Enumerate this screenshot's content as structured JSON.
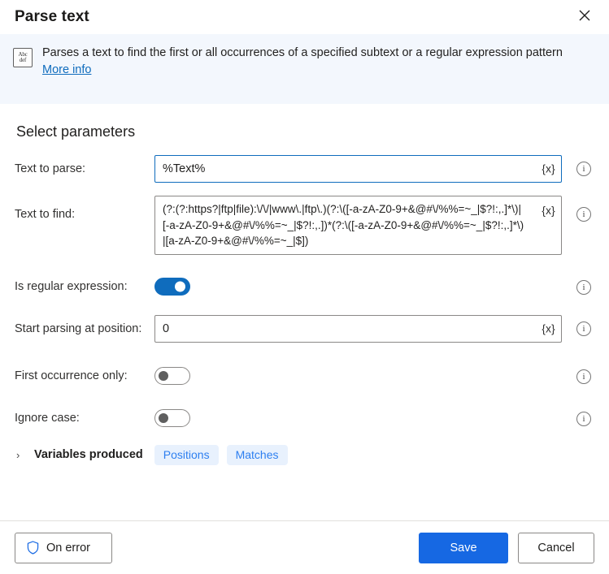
{
  "window": {
    "title": "Parse text",
    "close_label": "✕"
  },
  "banner": {
    "icon": "abc-def-text-icon",
    "icon_line1": "Abc",
    "icon_line2": "def",
    "description": "Parses a text to find the first or all occurrences of a specified subtext or a regular expression pattern",
    "link_label": "More info"
  },
  "form": {
    "section_title": "Select parameters",
    "variable_button_label": "{x}",
    "info_icon_label": "i",
    "fields": [
      {
        "label": "Text to parse:",
        "type": "text",
        "value": "%Text%",
        "focused": true,
        "has_variable_button": true,
        "has_info": true
      },
      {
        "label": "Text to find:",
        "type": "textarea",
        "value": "(?:(?:https?|ftp|file):\\/\\/|www\\.|ftp\\.)(?:\\([-a-zA-Z0-9+&@#\\/%%=~_|$?!:,.]*\\)|[-a-zA-Z0-9+&@#\\/%%=~_|$?!:,.])*(?:\\([-a-zA-Z0-9+&@#\\/%%=~_|$?!:,.]*\\)|[a-zA-Z0-9+&@#\\/%%=~_|$])",
        "focused": false,
        "has_variable_button": true,
        "has_info": true
      },
      {
        "label": "Is regular expression:",
        "type": "toggle",
        "state": "on",
        "has_info": true
      },
      {
        "label": "Start parsing at position:",
        "type": "text",
        "value": "0",
        "focused": false,
        "has_variable_button": true,
        "has_info": true
      },
      {
        "label": "First occurrence only:",
        "type": "toggle",
        "state": "off",
        "has_info": true
      },
      {
        "label": "Ignore case:",
        "type": "toggle",
        "state": "off",
        "has_info": true
      }
    ]
  },
  "variables_produced": {
    "chevron": "›",
    "label": "Variables produced",
    "chips": [
      "Positions",
      "Matches"
    ]
  },
  "footer": {
    "on_error_label": "On error",
    "save_label": "Save",
    "cancel_label": "Cancel"
  },
  "colors": {
    "accent": "#0f6cbd",
    "primary_button": "#1668e3",
    "banner_bg": "#f3f7fd",
    "chip_bg": "#e8f1fd",
    "chip_text": "#2d7ff0",
    "link": "#0f6cbd"
  }
}
